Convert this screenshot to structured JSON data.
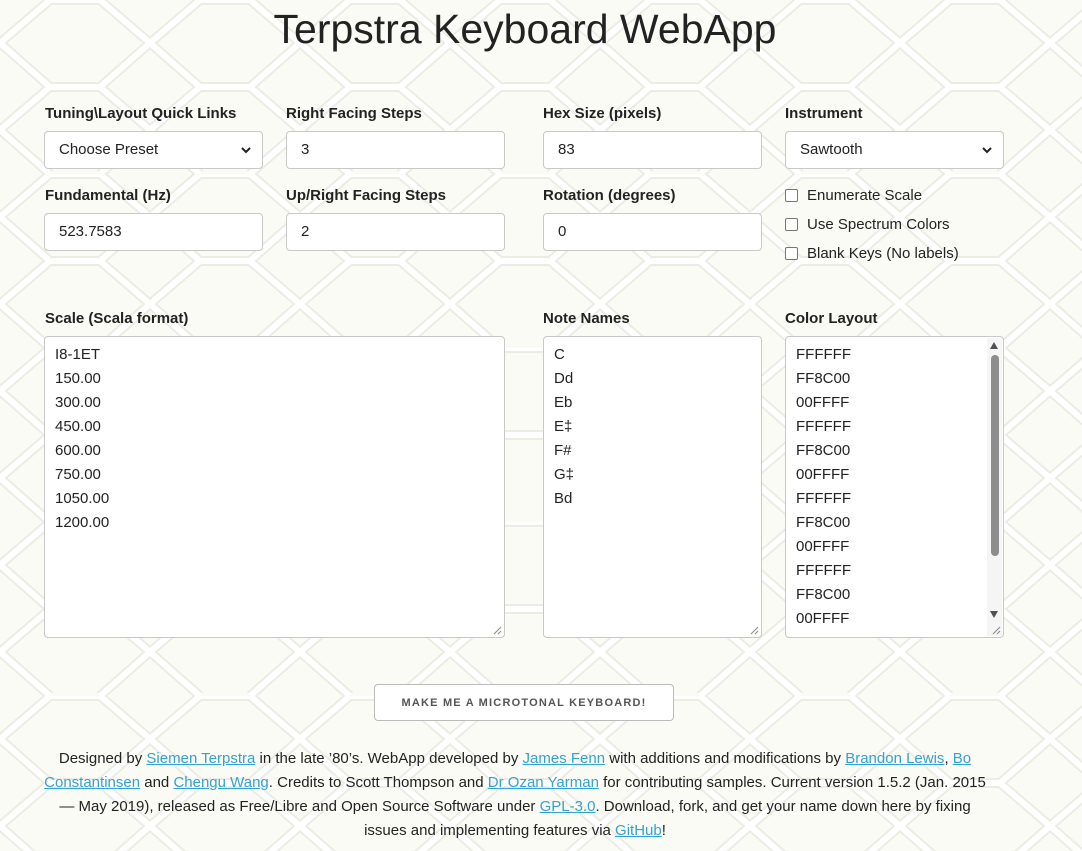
{
  "title": "Terpstra Keyboard WebApp",
  "colors": {
    "link": "#33a2cf",
    "text": "#222222",
    "border": "#c8c8c8"
  },
  "quick_links": {
    "label": "Tuning\\Layout Quick Links",
    "value": "Choose Preset"
  },
  "right_steps": {
    "label": "Right Facing Steps",
    "value": "3"
  },
  "hex_size": {
    "label": "Hex Size (pixels)",
    "value": "83"
  },
  "instrument": {
    "label": "Instrument",
    "value": "Sawtooth"
  },
  "fundamental": {
    "label": "Fundamental (Hz)",
    "value": "523.7583"
  },
  "upright_steps": {
    "label": "Up/Right Facing Steps",
    "value": "2"
  },
  "rotation": {
    "label": "Rotation (degrees)",
    "value": "0"
  },
  "checkboxes": {
    "enumerate": {
      "label": "Enumerate Scale",
      "checked": false
    },
    "spectrum": {
      "label": "Use Spectrum Colors",
      "checked": false
    },
    "blank": {
      "label": "Blank Keys (No labels)",
      "checked": false
    }
  },
  "scale": {
    "label": "Scale (Scala format)",
    "lines": [
      "I8-1ET",
      "150.00",
      "300.00",
      "450.00",
      "600.00",
      "750.00",
      "1050.00",
      "1200.00"
    ]
  },
  "note_names": {
    "label": "Note Names",
    "lines": [
      "C",
      "Dd",
      "Eb",
      "E‡",
      "F#",
      "G‡",
      "Bd"
    ]
  },
  "color_layout": {
    "label": "Color Layout",
    "lines": [
      "FFFFFF",
      "FF8C00",
      "00FFFF",
      "FFFFFF",
      "FF8C00",
      "00FFFF",
      "FFFFFF",
      "FF8C00",
      "00FFFF",
      "FFFFFF",
      "FF8C00",
      "00FFFF"
    ]
  },
  "submit_label": "MAKE ME A MICROTONAL KEYBOARD!",
  "footer": {
    "t1": "Designed by ",
    "l1": "Siemen Terpstra",
    "t2": " in the late ’80’s. WebApp developed by ",
    "l2": "James Fenn",
    "t3": " with additions and modifications by ",
    "l3": "Brandon Lewis",
    "t4": ", ",
    "l4": "Bo Constantinsen",
    "t5": " and ",
    "l5": "Chengu Wang",
    "t6": ". Credits to Scott Thompson and ",
    "l6": "Dr Ozan Yarman",
    "t7": " for contributing samples. Current version 1.5.2 (Jan. 2015 — May 2019), released as Free/Libre and Open Source Software under ",
    "l7": "GPL-3.0",
    "t8": ". Download, fork, and get your name down here by fixing issues and implementing features via ",
    "l8": "GitHub",
    "t9": "!"
  }
}
